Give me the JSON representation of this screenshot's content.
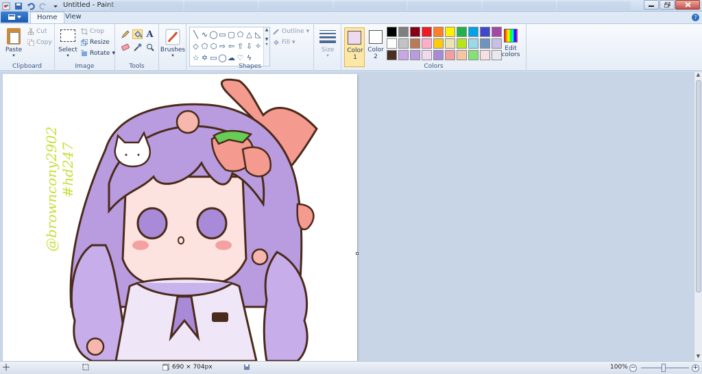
{
  "window": {
    "title": "Untitled - Paint"
  },
  "ribbon_tabs": [
    "Home",
    "View"
  ],
  "clipboard": {
    "paste": "Paste",
    "cut": "Cut",
    "copy": "Copy",
    "label": "Clipboard"
  },
  "image": {
    "select": "Select",
    "crop": "Crop",
    "resize": "Resize",
    "rotate": "Rotate",
    "label": "Image"
  },
  "tools": {
    "label": "Tools",
    "active": "fill-icon"
  },
  "brushes": {
    "label": "Brushes"
  },
  "shapes": {
    "outline": "Outline",
    "fill": "Fill",
    "label": "Shapes"
  },
  "size": {
    "label": "Size"
  },
  "colors": {
    "color1_label": "Color",
    "color1_num": "1",
    "color1_value": "#efd9ef",
    "color2_label": "Color",
    "color2_num": "2",
    "color2_value": "#ffffff",
    "edit_label": "Edit",
    "edit_label2": "colors",
    "group_label": "Colors",
    "palette": [
      "#000000",
      "#7f7f7f",
      "#880015",
      "#ed1c24",
      "#ff7f27",
      "#fff200",
      "#22b14c",
      "#00a2e8",
      "#3f48cc",
      "#a349a4",
      "#ffffff",
      "#c3c3c3",
      "#b97a57",
      "#ffaec9",
      "#ffc90e",
      "#efe4b0",
      "#b5e61d",
      "#99d9ea",
      "#7092be",
      "#c8bfe7",
      "#4a2f22",
      "#c9a6e6",
      "#b99be0",
      "#efd9ef",
      "#a98ad6",
      "#f0a0a0",
      "#f5c6a0",
      "#86e07a",
      "#f9e0e0",
      "#e8e8ee"
    ]
  },
  "canvas": {
    "watermark_1": "@browncony2902",
    "watermark_2": "#hd247"
  },
  "status": {
    "dimensions": "690 × 704px",
    "zoom": "100%"
  }
}
